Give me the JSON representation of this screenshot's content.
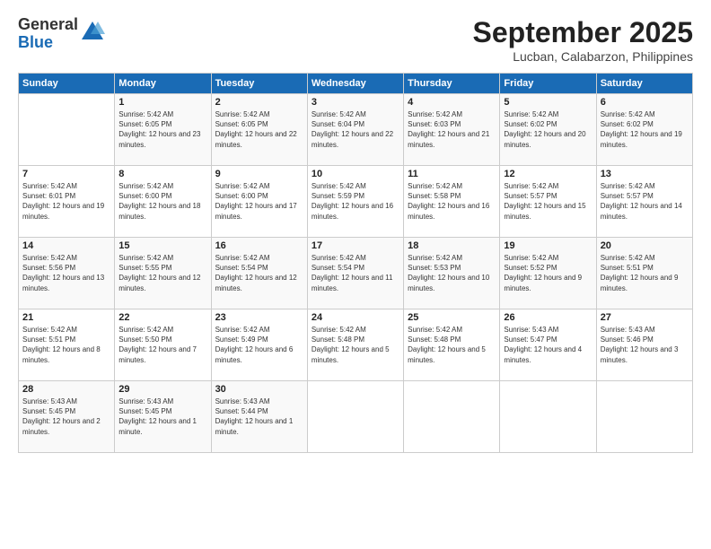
{
  "logo": {
    "general": "General",
    "blue": "Blue"
  },
  "title": "September 2025",
  "location": "Lucban, Calabarzon, Philippines",
  "headers": [
    "Sunday",
    "Monday",
    "Tuesday",
    "Wednesday",
    "Thursday",
    "Friday",
    "Saturday"
  ],
  "weeks": [
    [
      {
        "day": "",
        "sunrise": "",
        "sunset": "",
        "daylight": ""
      },
      {
        "day": "1",
        "sunrise": "Sunrise: 5:42 AM",
        "sunset": "Sunset: 6:05 PM",
        "daylight": "Daylight: 12 hours and 23 minutes."
      },
      {
        "day": "2",
        "sunrise": "Sunrise: 5:42 AM",
        "sunset": "Sunset: 6:05 PM",
        "daylight": "Daylight: 12 hours and 22 minutes."
      },
      {
        "day": "3",
        "sunrise": "Sunrise: 5:42 AM",
        "sunset": "Sunset: 6:04 PM",
        "daylight": "Daylight: 12 hours and 22 minutes."
      },
      {
        "day": "4",
        "sunrise": "Sunrise: 5:42 AM",
        "sunset": "Sunset: 6:03 PM",
        "daylight": "Daylight: 12 hours and 21 minutes."
      },
      {
        "day": "5",
        "sunrise": "Sunrise: 5:42 AM",
        "sunset": "Sunset: 6:02 PM",
        "daylight": "Daylight: 12 hours and 20 minutes."
      },
      {
        "day": "6",
        "sunrise": "Sunrise: 5:42 AM",
        "sunset": "Sunset: 6:02 PM",
        "daylight": "Daylight: 12 hours and 19 minutes."
      }
    ],
    [
      {
        "day": "7",
        "sunrise": "Sunrise: 5:42 AM",
        "sunset": "Sunset: 6:01 PM",
        "daylight": "Daylight: 12 hours and 19 minutes."
      },
      {
        "day": "8",
        "sunrise": "Sunrise: 5:42 AM",
        "sunset": "Sunset: 6:00 PM",
        "daylight": "Daylight: 12 hours and 18 minutes."
      },
      {
        "day": "9",
        "sunrise": "Sunrise: 5:42 AM",
        "sunset": "Sunset: 6:00 PM",
        "daylight": "Daylight: 12 hours and 17 minutes."
      },
      {
        "day": "10",
        "sunrise": "Sunrise: 5:42 AM",
        "sunset": "Sunset: 5:59 PM",
        "daylight": "Daylight: 12 hours and 16 minutes."
      },
      {
        "day": "11",
        "sunrise": "Sunrise: 5:42 AM",
        "sunset": "Sunset: 5:58 PM",
        "daylight": "Daylight: 12 hours and 16 minutes."
      },
      {
        "day": "12",
        "sunrise": "Sunrise: 5:42 AM",
        "sunset": "Sunset: 5:57 PM",
        "daylight": "Daylight: 12 hours and 15 minutes."
      },
      {
        "day": "13",
        "sunrise": "Sunrise: 5:42 AM",
        "sunset": "Sunset: 5:57 PM",
        "daylight": "Daylight: 12 hours and 14 minutes."
      }
    ],
    [
      {
        "day": "14",
        "sunrise": "Sunrise: 5:42 AM",
        "sunset": "Sunset: 5:56 PM",
        "daylight": "Daylight: 12 hours and 13 minutes."
      },
      {
        "day": "15",
        "sunrise": "Sunrise: 5:42 AM",
        "sunset": "Sunset: 5:55 PM",
        "daylight": "Daylight: 12 hours and 12 minutes."
      },
      {
        "day": "16",
        "sunrise": "Sunrise: 5:42 AM",
        "sunset": "Sunset: 5:54 PM",
        "daylight": "Daylight: 12 hours and 12 minutes."
      },
      {
        "day": "17",
        "sunrise": "Sunrise: 5:42 AM",
        "sunset": "Sunset: 5:54 PM",
        "daylight": "Daylight: 12 hours and 11 minutes."
      },
      {
        "day": "18",
        "sunrise": "Sunrise: 5:42 AM",
        "sunset": "Sunset: 5:53 PM",
        "daylight": "Daylight: 12 hours and 10 minutes."
      },
      {
        "day": "19",
        "sunrise": "Sunrise: 5:42 AM",
        "sunset": "Sunset: 5:52 PM",
        "daylight": "Daylight: 12 hours and 9 minutes."
      },
      {
        "day": "20",
        "sunrise": "Sunrise: 5:42 AM",
        "sunset": "Sunset: 5:51 PM",
        "daylight": "Daylight: 12 hours and 9 minutes."
      }
    ],
    [
      {
        "day": "21",
        "sunrise": "Sunrise: 5:42 AM",
        "sunset": "Sunset: 5:51 PM",
        "daylight": "Daylight: 12 hours and 8 minutes."
      },
      {
        "day": "22",
        "sunrise": "Sunrise: 5:42 AM",
        "sunset": "Sunset: 5:50 PM",
        "daylight": "Daylight: 12 hours and 7 minutes."
      },
      {
        "day": "23",
        "sunrise": "Sunrise: 5:42 AM",
        "sunset": "Sunset: 5:49 PM",
        "daylight": "Daylight: 12 hours and 6 minutes."
      },
      {
        "day": "24",
        "sunrise": "Sunrise: 5:42 AM",
        "sunset": "Sunset: 5:48 PM",
        "daylight": "Daylight: 12 hours and 5 minutes."
      },
      {
        "day": "25",
        "sunrise": "Sunrise: 5:42 AM",
        "sunset": "Sunset: 5:48 PM",
        "daylight": "Daylight: 12 hours and 5 minutes."
      },
      {
        "day": "26",
        "sunrise": "Sunrise: 5:43 AM",
        "sunset": "Sunset: 5:47 PM",
        "daylight": "Daylight: 12 hours and 4 minutes."
      },
      {
        "day": "27",
        "sunrise": "Sunrise: 5:43 AM",
        "sunset": "Sunset: 5:46 PM",
        "daylight": "Daylight: 12 hours and 3 minutes."
      }
    ],
    [
      {
        "day": "28",
        "sunrise": "Sunrise: 5:43 AM",
        "sunset": "Sunset: 5:45 PM",
        "daylight": "Daylight: 12 hours and 2 minutes."
      },
      {
        "day": "29",
        "sunrise": "Sunrise: 5:43 AM",
        "sunset": "Sunset: 5:45 PM",
        "daylight": "Daylight: 12 hours and 1 minute."
      },
      {
        "day": "30",
        "sunrise": "Sunrise: 5:43 AM",
        "sunset": "Sunset: 5:44 PM",
        "daylight": "Daylight: 12 hours and 1 minute."
      },
      {
        "day": "",
        "sunrise": "",
        "sunset": "",
        "daylight": ""
      },
      {
        "day": "",
        "sunrise": "",
        "sunset": "",
        "daylight": ""
      },
      {
        "day": "",
        "sunrise": "",
        "sunset": "",
        "daylight": ""
      },
      {
        "day": "",
        "sunrise": "",
        "sunset": "",
        "daylight": ""
      }
    ]
  ]
}
